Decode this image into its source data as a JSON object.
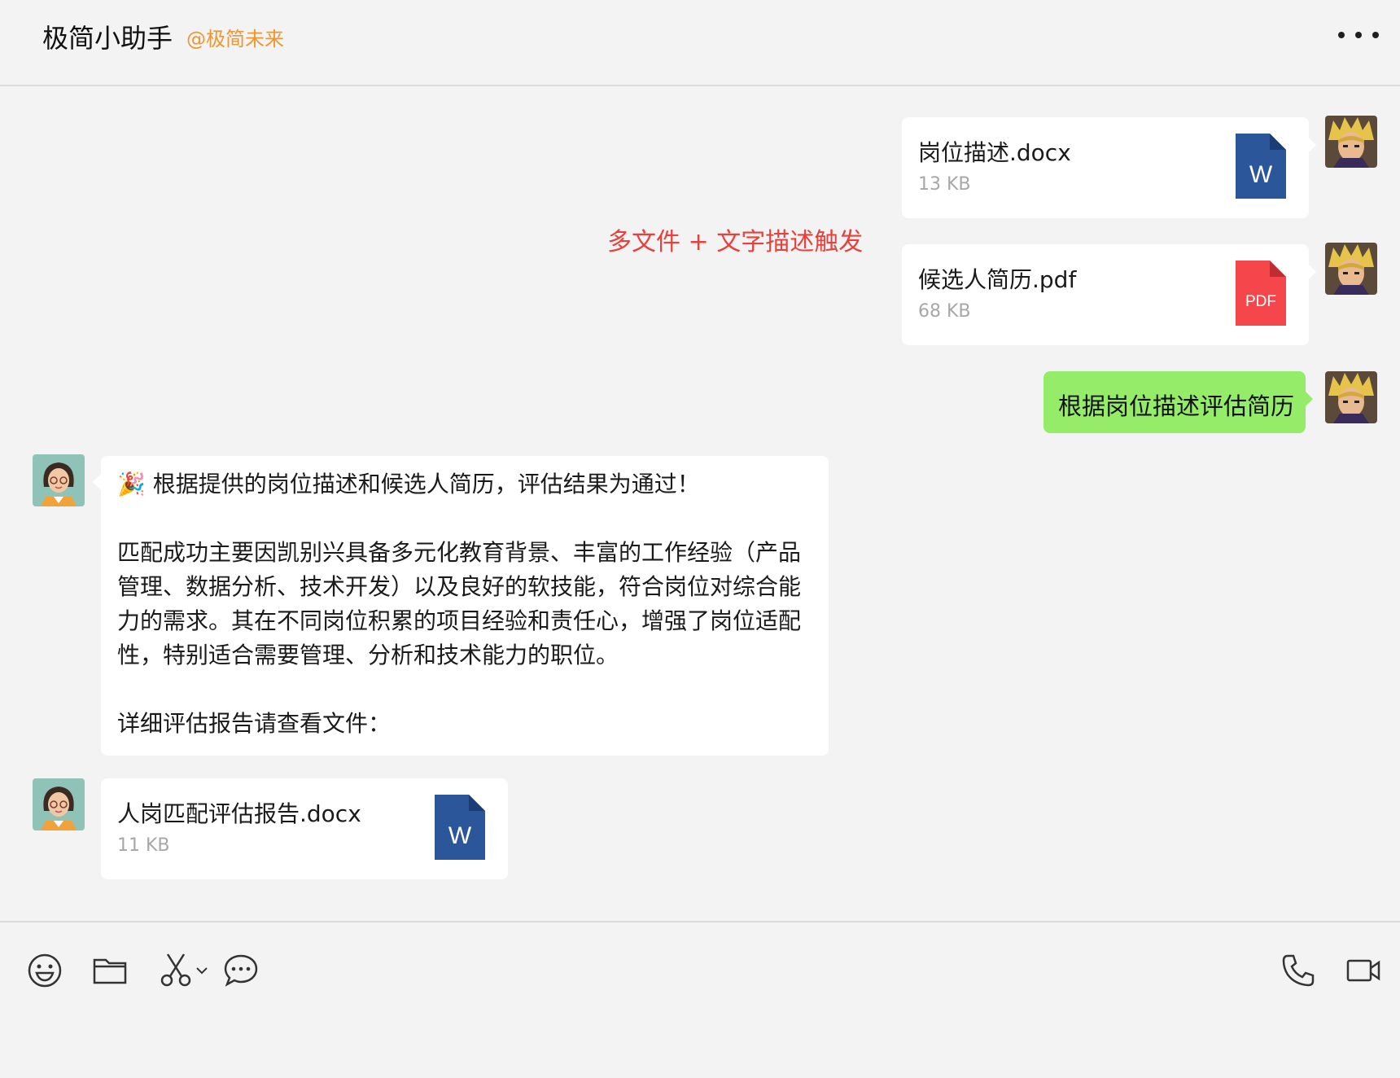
{
  "header": {
    "title": "极简小助手",
    "subtitle": "@极简未来"
  },
  "messages": {
    "file1": {
      "name": "岗位描述.docx",
      "size": "13 KB",
      "icon": "word-doc-icon",
      "icon_label": "W"
    },
    "file2": {
      "name": "候选人简历.pdf",
      "size": "68 KB",
      "icon": "pdf-doc-icon",
      "icon_label": "PDF"
    },
    "annotation": "多文件 + 文字描述触发",
    "user_text": "根据岗位描述评估简历",
    "reply": {
      "line1": "🎉 根据提供的岗位描述和候选人简历，评估结果为通过！",
      "line2": "匹配成功主要因凯别兴具备多元化教育背景、丰富的工作经验（产品",
      "line3": "管理、数据分析、技术开发）以及良好的软技能，符合岗位对综合能",
      "line4": "力的需求。其在不同岗位积累的项目经验和责任心，增强了岗位适配",
      "line5": "性，特别适合需要管理、分析和技术能力的职位。",
      "line6": "详细评估报告请查看文件："
    },
    "file3": {
      "name": "人岗匹配评估报告.docx",
      "size": "11 KB",
      "icon": "word-doc-icon",
      "icon_label": "W"
    }
  },
  "toolbar": {
    "left": [
      "emoji-icon",
      "folder-icon",
      "scissors-icon",
      "chat-history-icon"
    ],
    "right": [
      "phone-icon",
      "video-icon"
    ]
  },
  "colors": {
    "background": "#f3f3f3",
    "user_bubble": "#95ec69",
    "subtitle": "#f0962e",
    "annotation": "#e8413b",
    "word": "#2b579a",
    "pdf": "#f5474b"
  }
}
